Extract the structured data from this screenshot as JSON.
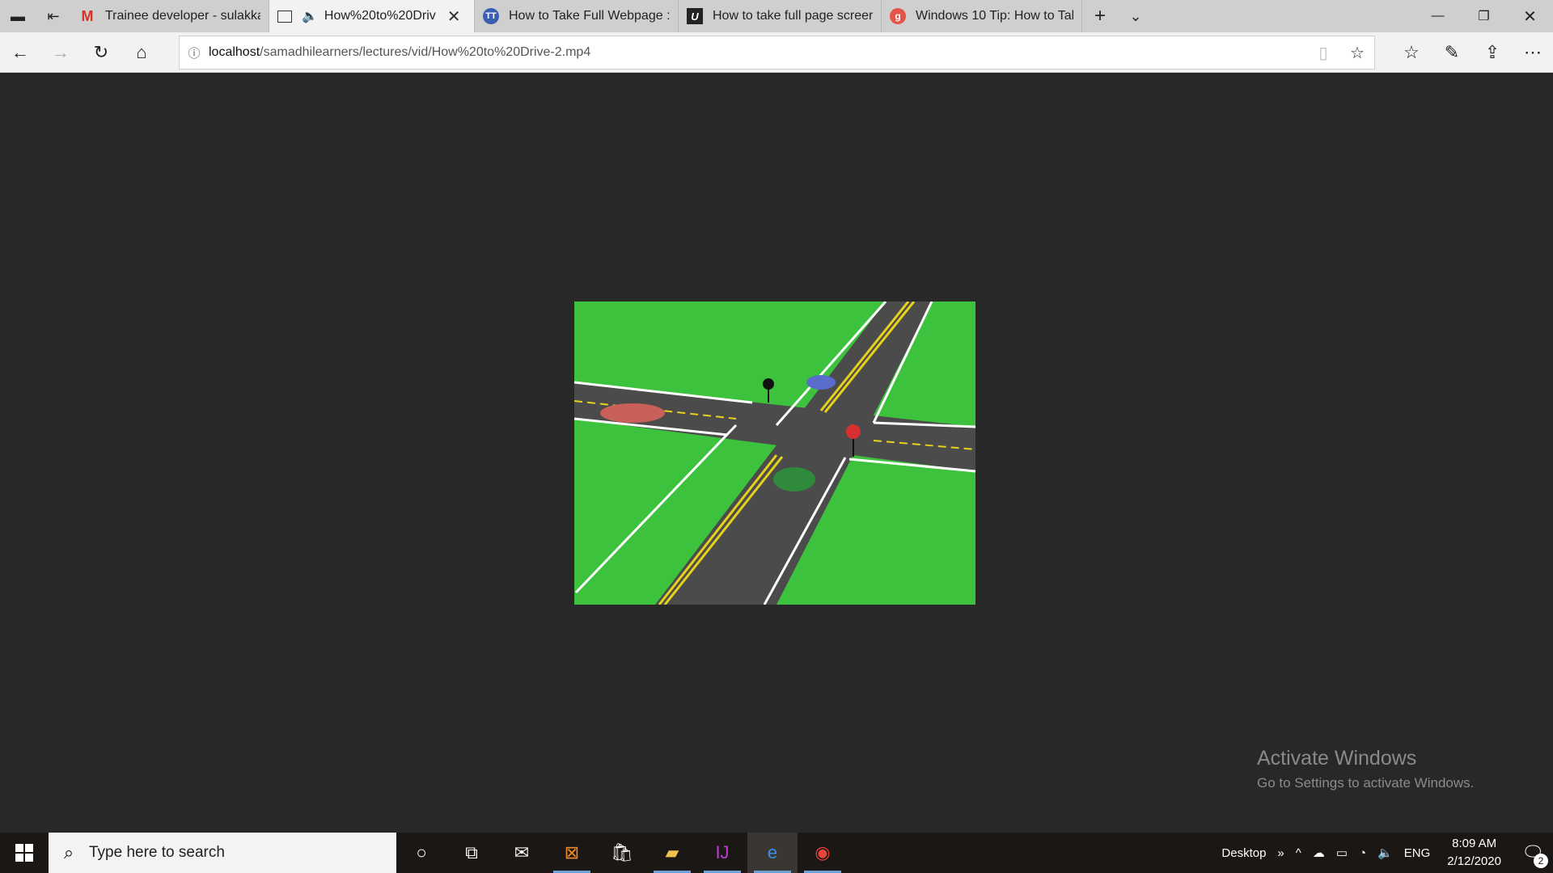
{
  "tabs": [
    {
      "title": "Trainee developer - sulakkai",
      "icon": "gmail-icon",
      "active": false
    },
    {
      "title": "How%20to%20Driv",
      "icon": "page-icon",
      "active": true,
      "audio": true
    },
    {
      "title": "How to Take Full Webpage :",
      "icon": "site-icon",
      "active": false
    },
    {
      "title": "How to take full page screer",
      "icon": "site-icon",
      "active": false
    },
    {
      "title": "Windows 10 Tip: How to Tal",
      "icon": "site-icon",
      "active": false
    }
  ],
  "address": {
    "host": "localhost",
    "path": "/samadhilearners/lectures/vid/How%20to%20Drive-2.mp4"
  },
  "watermark": {
    "heading": "Activate Windows",
    "sub": "Go to Settings to activate Windows."
  },
  "taskbar": {
    "search_placeholder": "Type here to search",
    "desktop_label": "Desktop",
    "lang": "ENG",
    "time": "8:09 AM",
    "date": "2/12/2020",
    "notifications": "2"
  },
  "colors": {
    "page_bg": "#282828",
    "grass": "#3cc23c",
    "road": "#4b4b4b"
  }
}
